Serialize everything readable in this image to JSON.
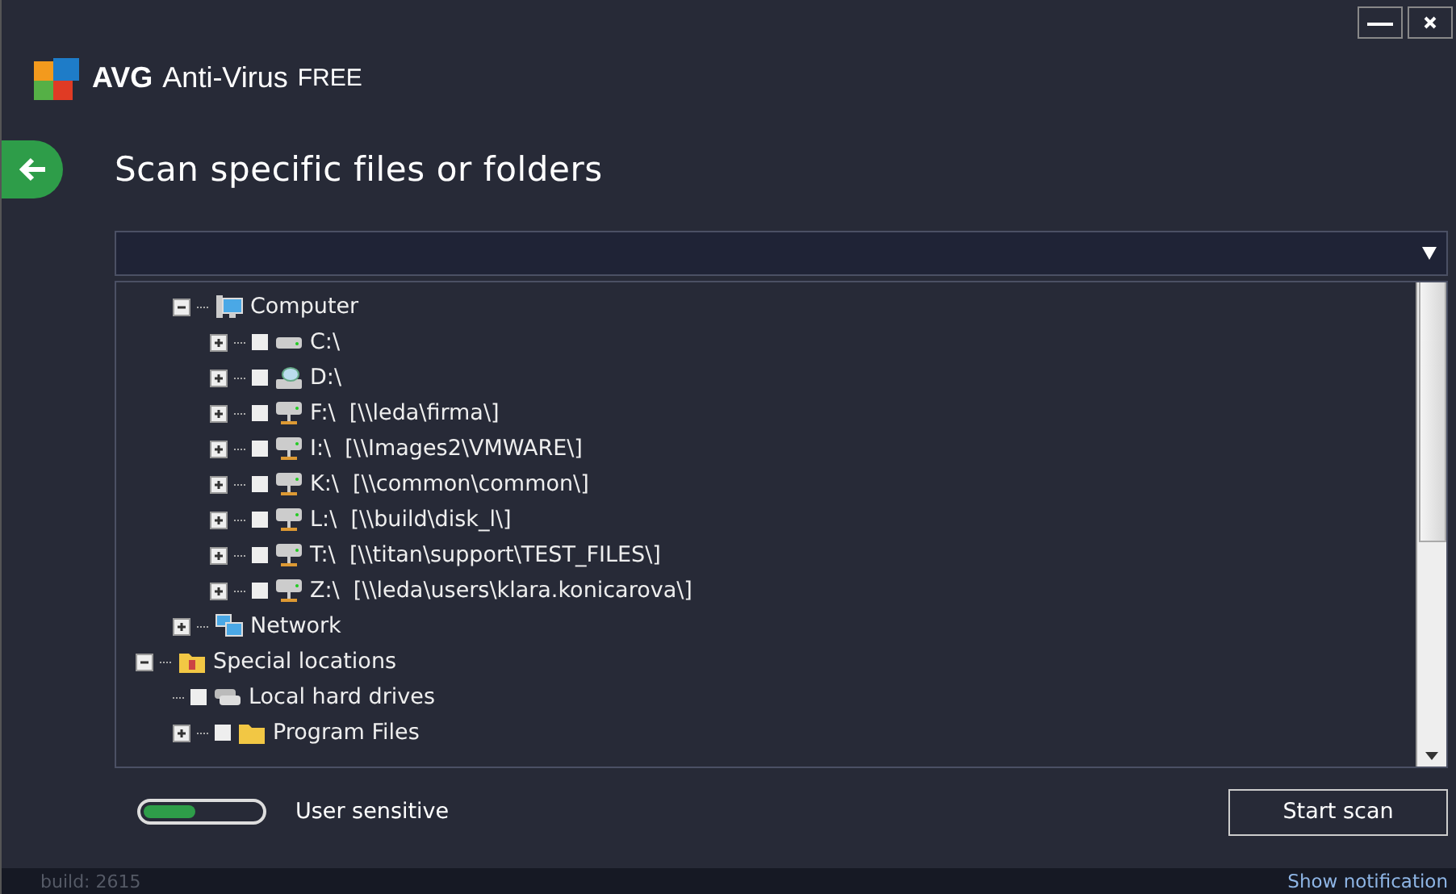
{
  "window": {
    "app_name": "AVG",
    "product": "Anti-Virus",
    "edition": "FREE"
  },
  "page": {
    "title": "Scan specific files or folders"
  },
  "tree": [
    {
      "children": [
        {
          "label": "Computer",
          "kind": "computer",
          "expanded": true,
          "children": [
            {
              "label": "C:\\",
              "kind": "disk",
              "checked": false,
              "expanded": false
            },
            {
              "label": "D:\\",
              "kind": "optical",
              "checked": false,
              "expanded": false
            },
            {
              "label": "F:\\  [\\\\leda\\firma\\]",
              "kind": "netdrive",
              "checked": false,
              "expanded": false
            },
            {
              "label": "I:\\  [\\\\Images2\\VMWARE\\]",
              "kind": "netdrive",
              "checked": false,
              "expanded": false
            },
            {
              "label": "K:\\  [\\\\common\\common\\]",
              "kind": "netdrive",
              "checked": false,
              "expanded": false
            },
            {
              "label": "L:\\  [\\\\build\\disk_l\\]",
              "kind": "netdrive",
              "checked": false,
              "expanded": false
            },
            {
              "label": "T:\\  [\\\\titan\\support\\TEST_FILES\\]",
              "kind": "netdrive",
              "checked": false,
              "expanded": false
            },
            {
              "label": "Z:\\  [\\\\leda\\users\\klara.konicarova\\]",
              "kind": "netdrive",
              "checked": false,
              "expanded": false
            }
          ]
        },
        {
          "label": "Network",
          "kind": "network",
          "expanded": false
        }
      ]
    },
    {
      "label": "Special locations",
      "kind": "special",
      "expanded": true,
      "children": [
        {
          "label": "Local hard drives",
          "kind": "disks",
          "checked": false
        },
        {
          "label": "Program Files",
          "kind": "folder",
          "checked": false,
          "expanded": false
        }
      ]
    }
  ],
  "sensitivity": {
    "label": "User sensitive",
    "level": 0.45
  },
  "start_button": {
    "label": "Start scan"
  },
  "status_bar": {
    "build": "build: 2615",
    "link": "Show notification"
  }
}
